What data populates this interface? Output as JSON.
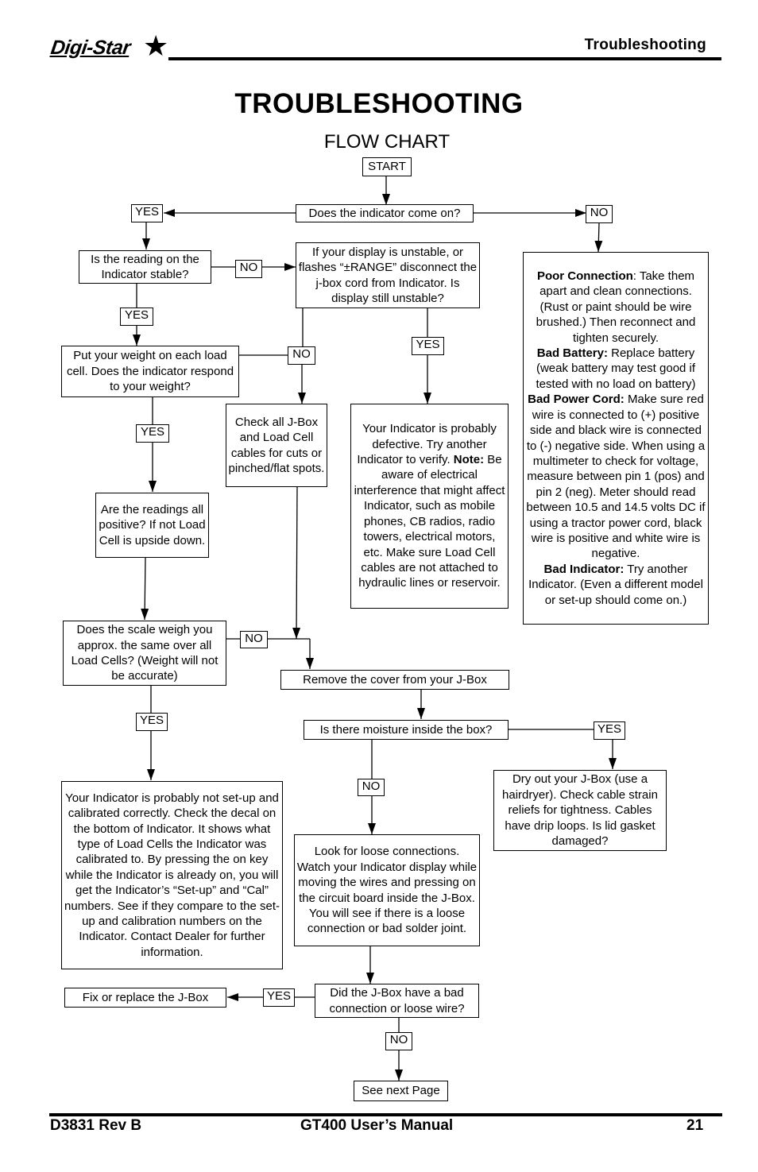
{
  "header": {
    "logo_text": "Digi-Star",
    "section": "Troubleshooting"
  },
  "title": "TROUBLESHOOTING",
  "subtitle": "FLOW CHART",
  "nodes": {
    "start": "START",
    "come_on": "Does the indicator come on?",
    "stable": "Is the reading on the Indicator stable?",
    "unstable": "If your display is unstable, or flashes “±RANGE” disconnect the j-box cord from Indicator. Is display still unstable?",
    "weight": "Put your weight on each load cell. Does the indicator respond to your weight?",
    "check_cables": "Check all J-Box and Load Cell cables for cuts or pinched/flat spots.",
    "defective_1": "Your Indicator is probably defective. Try another Indicator to verify.",
    "defective_note_label": "Note:",
    "defective_2": "Be aware of electrical interference that might affect Indicator, such as mobile phones, CB radios, radio towers, electrical motors, etc. Make sure Load Cell cables are not attached to hydraulic lines or reservoir.",
    "positive": "Are the readings all positive? If not Load Cell is upside down.",
    "same_weight": "Does the scale weigh you approx. the same over all Load Cells? (Weight will not be accurate)",
    "remove_cover": "Remove the cover from your J-Box",
    "moisture": "Is there moisture inside the box?",
    "dry_out": "Dry out your J-Box (use a hairdryer). Check cable strain reliefs for tightness. Cables have drip loops. Is lid gasket damaged?",
    "not_setup": "Your Indicator is probably not set-up and calibrated correctly. Check the decal on the bottom of Indicator. It shows what type of Load Cells the Indicator was calibrated to. By pressing the on key while the Indicator is already on, you will get the Indicator’s “Set-up” and “Cal” numbers. See if they compare to the set-up and calibration numbers on the Indicator. Contact Dealer for further information.",
    "loose": "Look for loose connections. Watch your Indicator display while moving the wires and pressing on the circuit board inside the J-Box. You will see if there is a loose connection or bad solder joint.",
    "bad_connection": "Did the J-Box have a bad connection or loose wire?",
    "fix_replace": "Fix or replace the J-Box",
    "see_next": "See next Page",
    "no_power": [
      {
        "label": "Poor Connection",
        "sep": ":",
        "text": " Take them apart and clean connections. (Rust or paint should be wire brushed.) Then reconnect and tighten securely."
      },
      {
        "label": "Bad Battery:",
        "sep": "",
        "text": " Replace battery (weak battery may test good if tested with no load on battery)"
      },
      {
        "label": "Bad Power Cord:",
        "sep": "",
        "text": " Make sure red wire is connected to (+) positive side and black wire is connected to (-) negative side. When using a multimeter to check for voltage, measure between pin 1 (pos) and pin 2 (neg). Meter should read between 10.5 and 14.5 volts DC if using a tractor power cord, black wire is positive and white wire is negative."
      },
      {
        "label": "Bad Indicator:",
        "sep": "",
        "text": " Try another Indicator. (Even a different model or set-up should come on.)"
      }
    ]
  },
  "labels": {
    "yes": "YES",
    "no": "NO"
  },
  "footer": {
    "doc_id": "D3831 Rev B",
    "manual": "GT400 User’s Manual",
    "page": "21"
  }
}
